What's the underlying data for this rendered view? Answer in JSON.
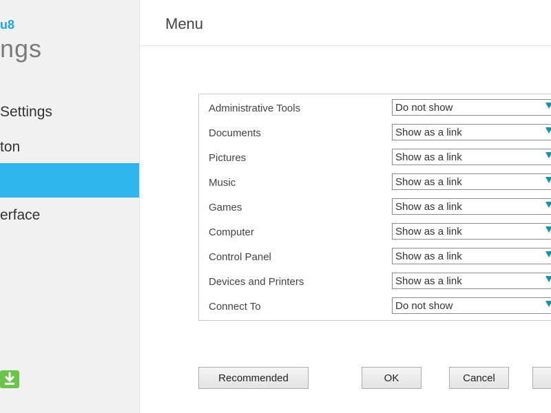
{
  "sidebar": {
    "brand": "u8",
    "title": "ngs",
    "items": [
      {
        "label": "Settings",
        "active": false
      },
      {
        "label": "ton",
        "active": false
      },
      {
        "label": "",
        "active": true
      },
      {
        "label": "erface",
        "active": false
      }
    ],
    "download_icon": "download-icon",
    "colors": {
      "accent": "#2eb6ec",
      "brand": "#1ca6e3",
      "download": "#6cc24a"
    }
  },
  "header": {
    "title": "Menu"
  },
  "options": [
    {
      "label": "Administrative Tools",
      "value": "Do not show"
    },
    {
      "label": "Documents",
      "value": "Show as a link"
    },
    {
      "label": "Pictures",
      "value": "Show as a link"
    },
    {
      "label": "Music",
      "value": "Show as a link"
    },
    {
      "label": "Games",
      "value": "Show as a link"
    },
    {
      "label": "Computer",
      "value": "Show as a link"
    },
    {
      "label": "Control Panel",
      "value": "Show as a link"
    },
    {
      "label": "Devices and Printers",
      "value": "Show as a link"
    },
    {
      "label": "Connect To",
      "value": "Do not show"
    }
  ],
  "buttons": {
    "recommended": "Recommended",
    "ok": "OK",
    "cancel": "Cancel",
    "apply": ""
  }
}
